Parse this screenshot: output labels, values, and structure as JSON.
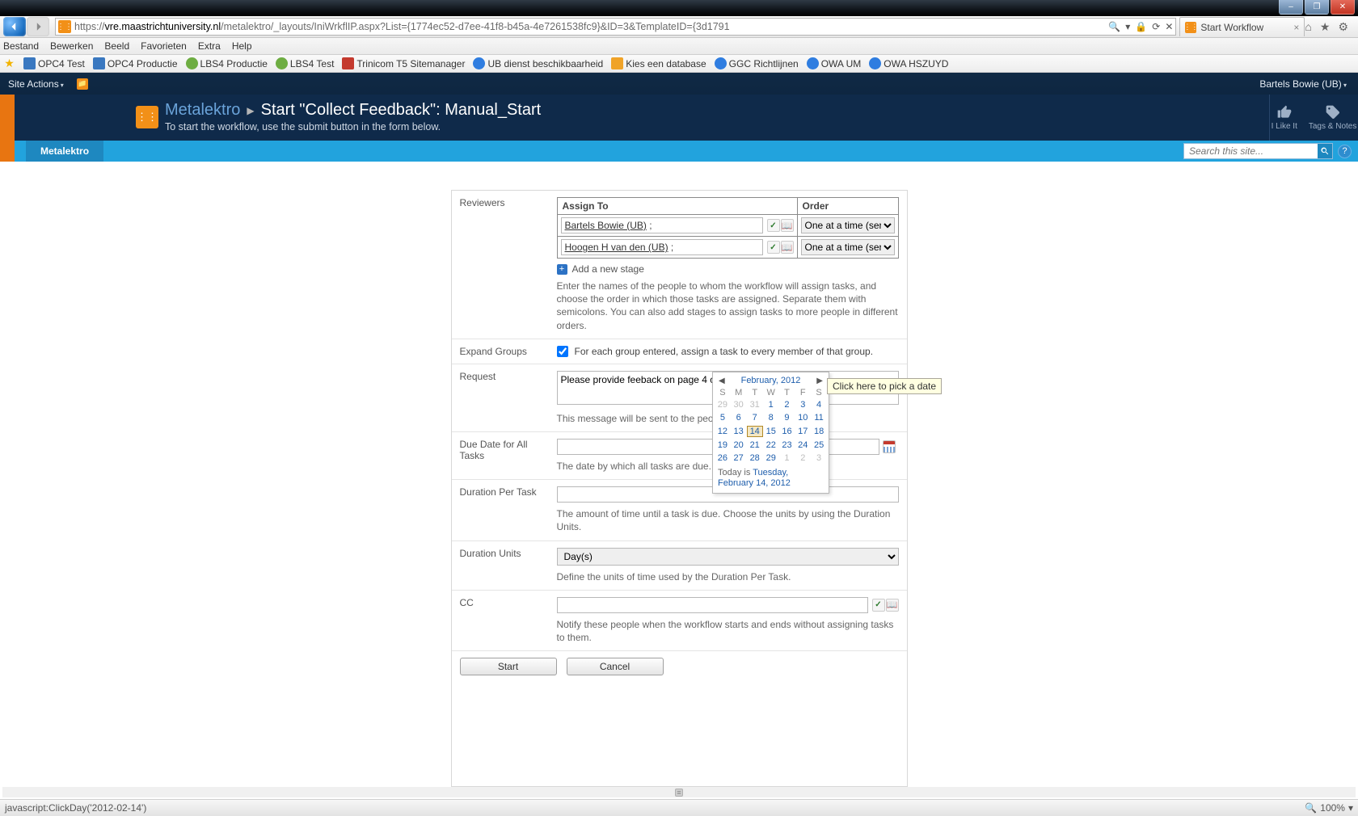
{
  "window": {
    "min_title": "–",
    "max_title": "❐",
    "close_title": "✕"
  },
  "browser": {
    "url_host": "vre.maastrichtuniversity.nl",
    "url_rest": "/metalektro/_layouts/IniWrkflIP.aspx?List={1774ec52-d7ee-41f8-b45a-4e7261538fc9}&ID=3&TemplateID={3d1791",
    "url_prefix": "https://",
    "refresh_icon": "⟳",
    "stop_icon": "✕",
    "lock_icon": "🔒",
    "search_icon": "🔍",
    "tab_title": "Start Workflow",
    "menu": [
      "Bestand",
      "Bewerken",
      "Beeld",
      "Favorieten",
      "Extra",
      "Help"
    ],
    "fav": [
      {
        "icon": "star",
        "label": ""
      },
      {
        "icon": "o1",
        "label": "OPC4 Test"
      },
      {
        "icon": "o2",
        "label": "OPC4 Productie"
      },
      {
        "icon": "green",
        "label": "LBS4 Productie"
      },
      {
        "icon": "green",
        "label": "LBS4 Test"
      },
      {
        "icon": "red",
        "label": "Trinicom T5 Sitemanager"
      },
      {
        "icon": "blue",
        "label": "UB dienst beschikbaarheid"
      },
      {
        "icon": "db",
        "label": "Kies een database"
      },
      {
        "icon": "ie",
        "label": "GGC Richtlijnen"
      },
      {
        "icon": "ie",
        "label": "OWA UM"
      },
      {
        "icon": "ie",
        "label": "OWA HSZUYD"
      }
    ],
    "home_icon": "⌂",
    "fav_icon": "★",
    "gear_icon": "⚙",
    "status_text": "javascript:ClickDay('2012-02-14')",
    "zoom": "100%"
  },
  "sp": {
    "site_actions": "Site Actions",
    "user": "Bartels Bowie (UB)",
    "breadcrumb_root": "Metalektro",
    "page_title": "Start \"Collect Feedback\": Manual_Start",
    "page_sub": "To start the workflow, use the submit button in the form below.",
    "ilikeit": "I Like It",
    "tags": "Tags & Notes",
    "topnav_tab": "Metalektro",
    "search_placeholder": "Search this site...",
    "help": "?"
  },
  "form": {
    "labels": {
      "reviewers": "Reviewers",
      "expand": "Expand Groups",
      "request": "Request",
      "due": "Due Date for All Tasks",
      "dpt": "Duration Per Task",
      "dunits": "Duration Units",
      "cc": "CC"
    },
    "assign_headers": {
      "to": "Assign To",
      "order": "Order"
    },
    "reviewers": [
      {
        "name": "Bartels Bowie (UB)",
        "order": "One at a time (serial)"
      },
      {
        "name": "Hoogen H van den (UB)",
        "order": "One at a time (serial)"
      }
    ],
    "add_stage": "Add a new stage",
    "reviewers_help": "Enter the names of the people to whom the workflow will assign tasks, and choose the order in which those tasks are assigned. Separate them with semicolons. You can also add stages to assign tasks to more people in different orders.",
    "expand_checked": true,
    "expand_text": "For each group entered, assign a task to every member of that group.",
    "request_value": "Please provide feeback on page 4 chapter 2",
    "request_help": "This message will be sent to the people assigned tasks.",
    "due_value": "",
    "due_help": "The date by which all tasks are due.",
    "dpt_value": "",
    "dpt_help": "The amount of time until a task is due. Choose the units by using the Duration Units.",
    "dunits_value": "Day(s)",
    "dunits_help": "Define the units of time used by the Duration Per Task.",
    "cc_value": "",
    "cc_help": "Notify these people when the workflow starts and ends without assigning tasks to them.",
    "btn_start": "Start",
    "btn_cancel": "Cancel",
    "tooltip": "Click here to pick a date"
  },
  "calendar": {
    "title": "February, 2012",
    "dow": [
      "S",
      "M",
      "T",
      "W",
      "T",
      "F",
      "S"
    ],
    "leading_out": [
      29,
      30,
      31
    ],
    "days": [
      1,
      2,
      3,
      4,
      5,
      6,
      7,
      8,
      9,
      10,
      11,
      12,
      13,
      14,
      15,
      16,
      17,
      18,
      19,
      20,
      21,
      22,
      23,
      24,
      25,
      26,
      27,
      28,
      29
    ],
    "trailing_out": [
      1,
      2,
      3
    ],
    "today_num": 14,
    "today_label_prefix": "Today is ",
    "today_label_link": "Tuesday, February 14, 2012"
  }
}
